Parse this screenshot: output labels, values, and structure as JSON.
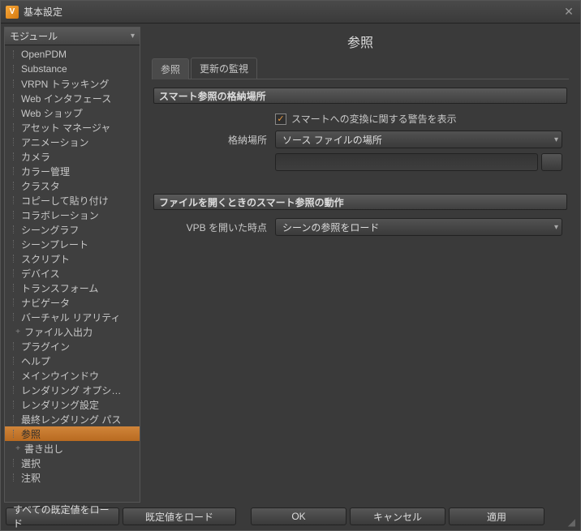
{
  "window": {
    "title": "基本設定"
  },
  "sidebar": {
    "header": "モジュール",
    "items": [
      {
        "label": "OpenPDM",
        "expander": ""
      },
      {
        "label": "Substance",
        "expander": ""
      },
      {
        "label": "VRPN トラッキング",
        "expander": ""
      },
      {
        "label": "Web インタフェース",
        "expander": ""
      },
      {
        "label": "Web ショップ",
        "expander": ""
      },
      {
        "label": "アセット マネージャ",
        "expander": ""
      },
      {
        "label": "アニメーション",
        "expander": ""
      },
      {
        "label": "カメラ",
        "expander": ""
      },
      {
        "label": "カラー管理",
        "expander": ""
      },
      {
        "label": "クラスタ",
        "expander": ""
      },
      {
        "label": "コピーして貼り付け",
        "expander": ""
      },
      {
        "label": "コラボレーション",
        "expander": ""
      },
      {
        "label": "シーングラフ",
        "expander": ""
      },
      {
        "label": "シーンプレート",
        "expander": ""
      },
      {
        "label": "スクリプト",
        "expander": ""
      },
      {
        "label": "デバイス",
        "expander": ""
      },
      {
        "label": "トランスフォーム",
        "expander": ""
      },
      {
        "label": "ナビゲータ",
        "expander": ""
      },
      {
        "label": "バーチャル リアリティ",
        "expander": ""
      },
      {
        "label": "ファイル入出力",
        "expander": "+"
      },
      {
        "label": "プラグイン",
        "expander": ""
      },
      {
        "label": "ヘルプ",
        "expander": ""
      },
      {
        "label": "メインウインドウ",
        "expander": ""
      },
      {
        "label": "レンダリング オプシ…",
        "expander": ""
      },
      {
        "label": "レンダリング設定",
        "expander": ""
      },
      {
        "label": "最終レンダリング パス",
        "expander": ""
      },
      {
        "label": "参照",
        "expander": "",
        "selected": true
      },
      {
        "label": "書き出し",
        "expander": "+"
      },
      {
        "label": "選択",
        "expander": ""
      },
      {
        "label": "注釈",
        "expander": ""
      }
    ]
  },
  "content": {
    "page_title": "参照",
    "tabs": [
      {
        "label": "参照",
        "active": true
      },
      {
        "label": "更新の監視",
        "active": false
      }
    ],
    "group1": {
      "title": "スマート参照の格納場所",
      "checkbox_label": "スマートへの変換に関する警告を表示",
      "checkbox_checked": true,
      "location_label": "格納場所",
      "location_value": "ソース ファイルの場所",
      "path_value": ""
    },
    "group2": {
      "title": "ファイルを開くときのスマート参照の動作",
      "open_label": "VPB を開いた時点",
      "open_value": "シーンの参照をロード"
    }
  },
  "footer": {
    "load_all_defaults": "すべての既定値をロード",
    "load_defaults": "既定値をロード",
    "ok": "OK",
    "cancel": "キャンセル",
    "apply": "適用"
  }
}
